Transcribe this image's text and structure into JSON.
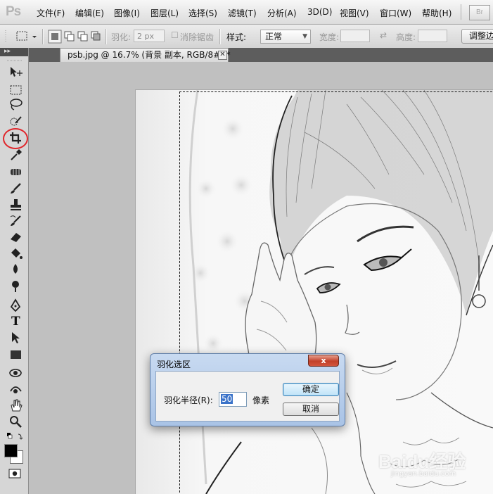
{
  "app": {
    "logo": "Ps",
    "bridge_badge": "Br"
  },
  "menu": {
    "items": [
      "文件(F)",
      "编辑(E)",
      "图像(I)",
      "图层(L)",
      "选择(S)",
      "滤镜(T)",
      "分析(A)",
      "3D(D)",
      "视图(V)",
      "窗口(W)",
      "帮助(H)"
    ]
  },
  "options": {
    "feather_label": "羽化:",
    "feather_value": "2 px",
    "antialias_label": "消除锯齿",
    "style_label": "样式:",
    "style_value": "正常",
    "width_label": "宽度:",
    "height_label": "高度:",
    "refine_edge_label": "调整边"
  },
  "document": {
    "tab_title": "psb.jpg @ 16.7% (背景 副本, RGB/8#) *",
    "tab_close": "✕"
  },
  "tools": {
    "header_arrows": "▸▸",
    "items": [
      "move-tool",
      "rectangular-marquee-tool",
      "lasso-tool",
      "quick-selection-tool",
      "crop-tool",
      "eyedropper-tool",
      "spot-healing-tool",
      "brush-tool",
      "clone-stamp-tool",
      "history-brush-tool",
      "eraser-tool",
      "paint-bucket-tool",
      "blur-tool",
      "dodge-tool",
      "pen-tool",
      "type-tool",
      "path-selection-tool",
      "rectangle-tool",
      "3d-rotate-tool",
      "3d-orbit-tool",
      "hand-tool",
      "zoom-tool"
    ],
    "foreground_color": "#000000",
    "background_color": "#ffffff",
    "type_tool_glyph": "T"
  },
  "dialog": {
    "title": "羽化选区",
    "radius_label": "羽化半径(R):",
    "radius_value": "50",
    "unit": "像素",
    "ok": "确定",
    "cancel": "取消",
    "close_glyph": "x"
  },
  "watermark": {
    "text": "Baidu经验",
    "sub": "jingyan.baidu.com"
  },
  "colors": {
    "highlight": "#e0262b",
    "selection_blue": "#3b73c9"
  }
}
